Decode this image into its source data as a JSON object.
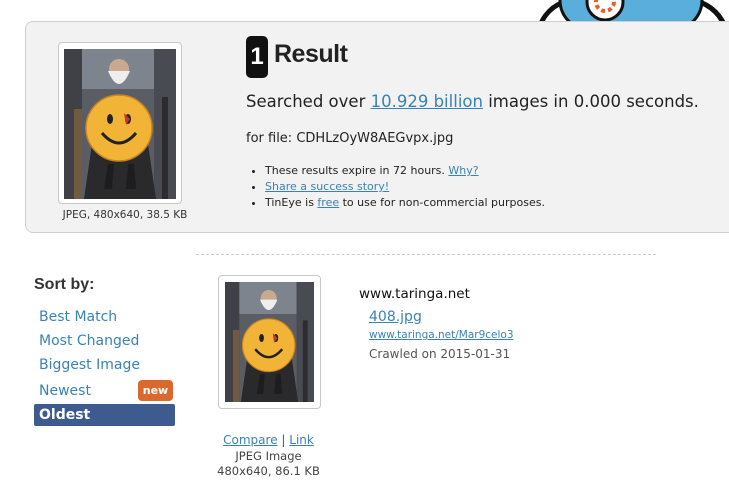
{
  "summary": {
    "result_count": "1",
    "result_word": "Result",
    "searched_prefix": "Searched over ",
    "index_size": "10.929 billion",
    "searched_suffix": " images in 0.000 seconds.",
    "file_prefix": "for file: ",
    "file_name": "CDHLzOyW8AEGvpx.jpg",
    "query_meta": "JPEG, 480x640, 38.5 KB",
    "notes": {
      "expire_text": "These results expire in 72 hours. ",
      "expire_link": "Why?",
      "share_link": "Share a success story!",
      "free_prefix": "TinEye is ",
      "free_link": "free",
      "free_suffix": " to use for non-commercial purposes."
    }
  },
  "sort": {
    "heading": "Sort by:",
    "options": [
      "Best Match",
      "Most Changed",
      "Biggest Image",
      "Newest",
      "Oldest"
    ],
    "selected": "Oldest",
    "new_badge": "new"
  },
  "match": {
    "compare_label": "Compare",
    "separator": "|",
    "link_label": "Link",
    "image_type": "JPEG Image",
    "image_meta": "480x640, 86.1 KB",
    "domain": "www.taringa.net",
    "file": "408.jpg",
    "url": "www.taringa.net/Mar9celo3",
    "crawled": "Crawled on 2015-01-31"
  },
  "colors": {
    "link": "#3a82b5",
    "selected_sort": "#3d5b8e",
    "new_badge": "#d9692c",
    "panel": "#f2f2f2"
  },
  "icons": {
    "mascot": "tineye-robot-icon"
  }
}
